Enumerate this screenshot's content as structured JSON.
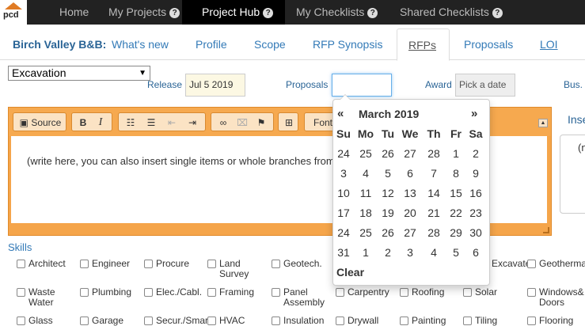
{
  "nav": {
    "logo_text": "pcd",
    "items": [
      {
        "label": "Home",
        "help": false
      },
      {
        "label": "My Projects",
        "help": true
      },
      {
        "label": "Project Hub",
        "help": true
      },
      {
        "label": "My Checklists",
        "help": true
      },
      {
        "label": "Shared Checklists",
        "help": true
      }
    ],
    "active": "Project Hub",
    "help_glyph": "?"
  },
  "project": {
    "name": "Birch Valley B&B:"
  },
  "tabs": [
    "What's new",
    "Profile",
    "Scope",
    "RFP Synopsis",
    "RFPs",
    "Proposals",
    "LOI"
  ],
  "active_tab": "RFPs",
  "form": {
    "trade_select": "Excavation",
    "release_label": "Release",
    "release_value": "Jul 5 2019",
    "proposals_label": "Proposals",
    "proposals_value": "",
    "award_label": "Award",
    "award_placeholder": "Pick a date",
    "bus_label": "Bus."
  },
  "editor": {
    "source_label": "Source",
    "bold": "B",
    "italic": "I",
    "font_label": "Font",
    "placeholder": "(write here, you can also insert single items or whole branches from"
  },
  "insert": {
    "label": "Inse",
    "box_text": "(n"
  },
  "skills": {
    "heading": "Skills",
    "items": [
      "Architect",
      "Engineer",
      "Procure",
      "Land Survey",
      "Geotech.",
      "Excavate",
      "Geotherma",
      "Waste Water",
      "Plumbing",
      "Elec./Cabl.",
      "Framing",
      "Panel Assembly",
      "Carpentry",
      "Roofing",
      "Solar",
      "Windows& Doors",
      "Glass",
      "Garage",
      "Secur./Smar",
      "HVAC",
      "Insulation",
      "Drywall",
      "Painting",
      "Tiling",
      "Flooring"
    ]
  },
  "datepicker": {
    "prev": "«",
    "next": "»",
    "title": "March 2019",
    "weekdays": [
      "Su",
      "Mo",
      "Tu",
      "We",
      "Th",
      "Fr",
      "Sa"
    ],
    "weeks": [
      [
        "24",
        "25",
        "26",
        "27",
        "28",
        "1",
        "2"
      ],
      [
        "3",
        "4",
        "5",
        "6",
        "7",
        "8",
        "9"
      ],
      [
        "10",
        "11",
        "12",
        "13",
        "14",
        "15",
        "16"
      ],
      [
        "17",
        "18",
        "19",
        "20",
        "21",
        "22",
        "23"
      ],
      [
        "24",
        "25",
        "26",
        "27",
        "28",
        "29",
        "30"
      ],
      [
        "31",
        "1",
        "2",
        "3",
        "4",
        "5",
        "6"
      ]
    ],
    "clear": "Clear"
  }
}
